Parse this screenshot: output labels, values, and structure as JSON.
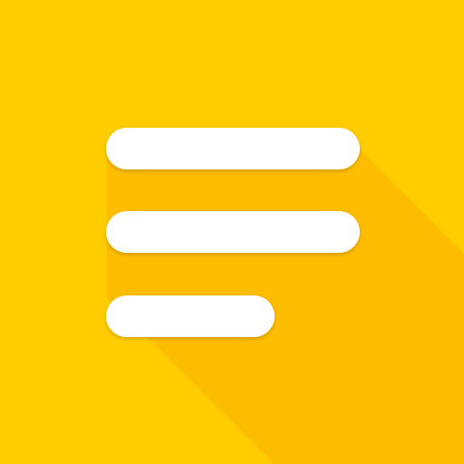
{
  "icon": {
    "name": "menu-lines-icon",
    "colors": {
      "background": "#FFCC00",
      "shadow": "#FFBD00",
      "bars": "#FFFFFF"
    }
  }
}
